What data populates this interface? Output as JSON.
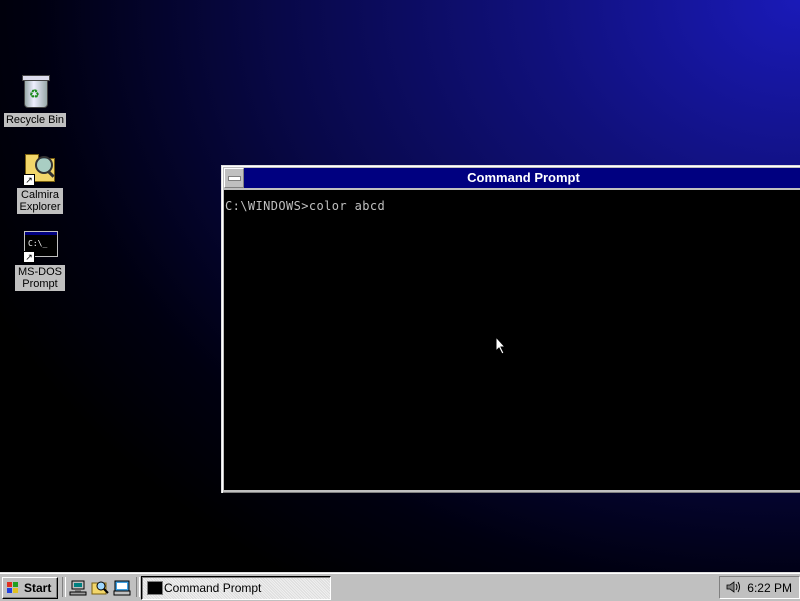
{
  "desktop": {
    "icons": [
      {
        "label": "Recycle Bin",
        "icon": "recycle-bin-icon"
      },
      {
        "label": "Calmira Explorer",
        "icon": "explorer-icon"
      },
      {
        "label": "MS-DOS Prompt",
        "icon": "msdos-prompt-icon"
      }
    ]
  },
  "window": {
    "title": "Command Prompt",
    "console_lines": [
      "C:\\WINDOWS>color abcd"
    ]
  },
  "taskbar": {
    "start_label": "Start",
    "quick_launch": [
      "network-icon",
      "explorer-search-icon",
      "folder-drive-icon"
    ],
    "tasks": [
      {
        "label": "Command Prompt",
        "icon": "console-icon"
      }
    ],
    "clock": "6:22 PM"
  },
  "colors": {
    "title_bar": "#000080",
    "console_bg": "#000000",
    "console_fg": "#c0c0c0",
    "chrome": "#c0c0c0"
  }
}
